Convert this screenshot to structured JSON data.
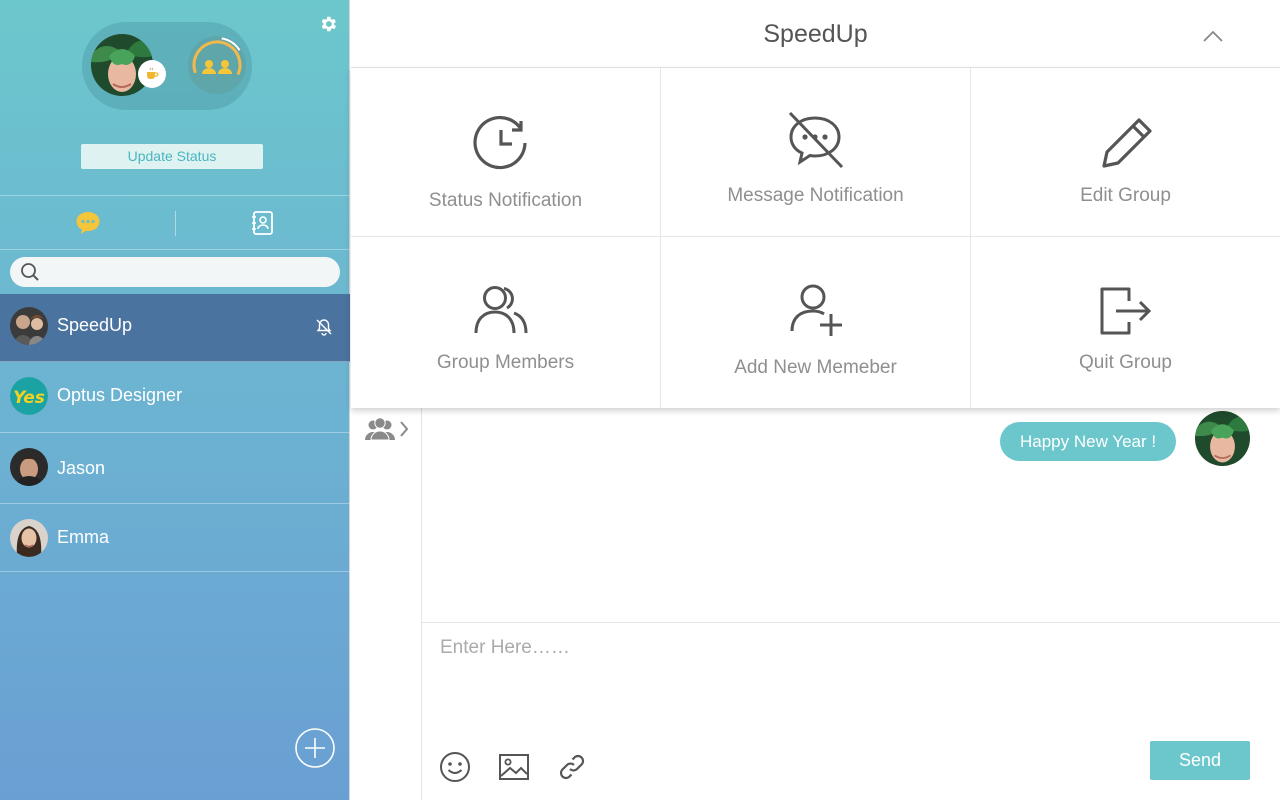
{
  "sidebar": {
    "update_status_label": "Update Status",
    "search": {
      "placeholder": "",
      "value": ""
    },
    "chats": [
      {
        "name": "SpeedUp",
        "active": true,
        "muted": true
      },
      {
        "name": "Optus Designer",
        "avatar_text": "Yes"
      },
      {
        "name": "Jason"
      },
      {
        "name": "Emma"
      }
    ]
  },
  "header": {
    "title": "SpeedUp"
  },
  "menu": {
    "items": [
      {
        "label": "Status Notification",
        "icon": "clock-icon"
      },
      {
        "label": "Message Notification",
        "icon": "message-off-icon"
      },
      {
        "label": "Edit Group",
        "icon": "pencil-icon"
      },
      {
        "label": "Group Members",
        "icon": "users-icon"
      },
      {
        "label": "Add New Memeber",
        "icon": "user-plus-icon"
      },
      {
        "label": "Quit Group",
        "icon": "logout-icon"
      }
    ]
  },
  "messages": [
    {
      "text": "Happy New Year !",
      "from_self": true
    }
  ],
  "composer": {
    "placeholder": "Enter Here……",
    "send_label": "Send"
  },
  "colors": {
    "accent": "#6cc7cc",
    "sidebar_top": "#6cc7cc",
    "sidebar_bottom": "#6a9fd3",
    "active_row": "#4b73a0",
    "chat_icon": "#f5c53a"
  }
}
